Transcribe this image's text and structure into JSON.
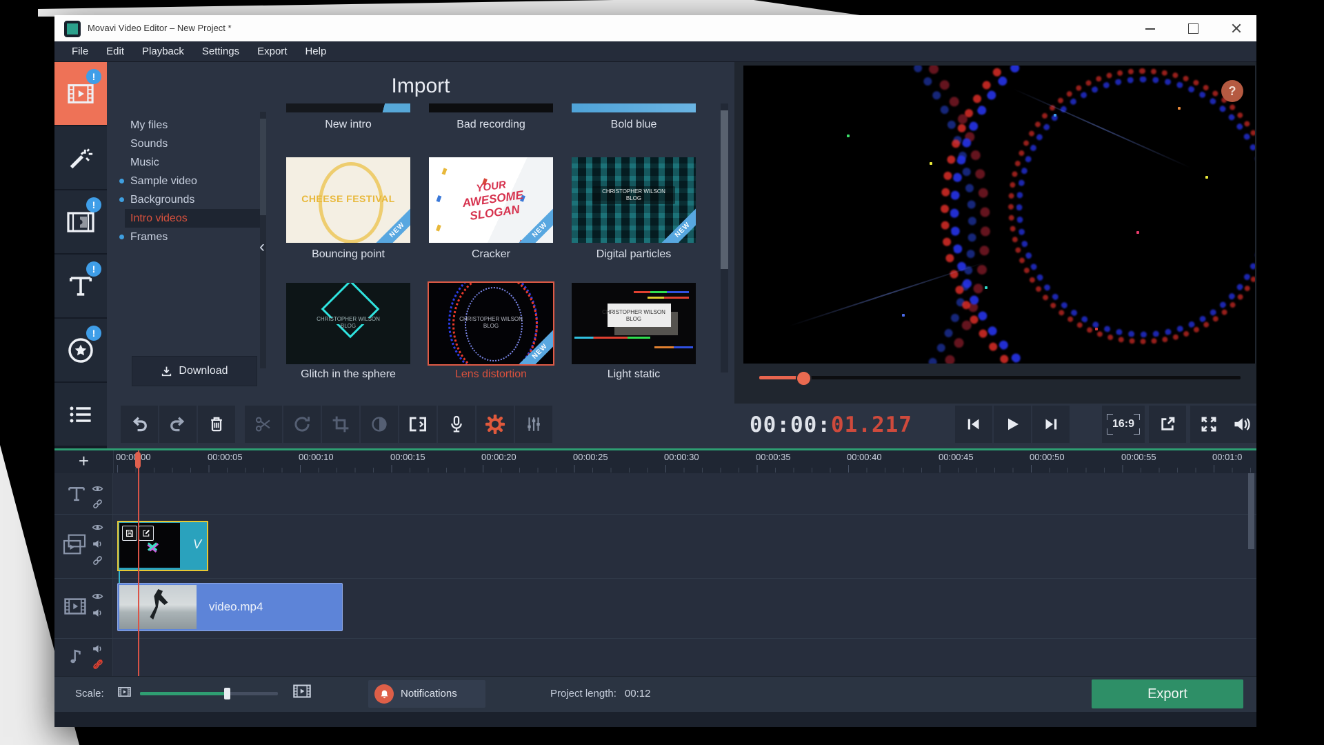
{
  "colors": {
    "accent_orange": "#ee7257",
    "selection_red": "#d9513d",
    "export_green": "#2e8f67",
    "clip_teal": "#2aa2bd",
    "clip_blue": "#5d84d8",
    "new_ribbon_blue": "#58a7e0",
    "timecode_red": "#cf4a3c",
    "scale_green": "#2f9e72"
  },
  "app": {
    "title": "Movavi Video Editor – New Project *",
    "menu": [
      "File",
      "Edit",
      "Playback",
      "Settings",
      "Export",
      "Help"
    ],
    "window_controls": [
      "minimize",
      "maximize",
      "close"
    ]
  },
  "sidebar": {
    "items": [
      {
        "name": "import",
        "badge": "!",
        "active": true
      },
      {
        "name": "filters",
        "active": false
      },
      {
        "name": "transitions",
        "badge": "!",
        "active": false
      },
      {
        "name": "titles",
        "badge": "!",
        "active": false
      },
      {
        "name": "stickers",
        "badge": "!",
        "active": false
      },
      {
        "name": "more-tools",
        "active": false
      }
    ]
  },
  "import_panel": {
    "title": "Import",
    "collapse_icon": "‹",
    "download_label": "Download",
    "categories": [
      {
        "label": "My files",
        "bullet": false,
        "selected": false
      },
      {
        "label": "Sounds",
        "bullet": false,
        "selected": false
      },
      {
        "label": "Music",
        "bullet": false,
        "selected": false
      },
      {
        "label": "Sample video",
        "bullet": true,
        "selected": false
      },
      {
        "label": "Backgrounds",
        "bullet": true,
        "selected": false
      },
      {
        "label": "Intro videos",
        "bullet": false,
        "selected": true
      },
      {
        "label": "Frames",
        "bullet": true,
        "selected": false
      }
    ],
    "row_top": [
      {
        "label": "New intro"
      },
      {
        "label": "Bad recording"
      },
      {
        "label": "Bold blue"
      }
    ],
    "row_middle": [
      {
        "label": "Bouncing point",
        "caption": "CHEESE FESTIVAL",
        "badge": "NEW"
      },
      {
        "label": "Cracker",
        "caption_line1": "YOUR",
        "caption_line2": "AWESOME SLOGAN",
        "badge": "NEW"
      },
      {
        "label": "Digital particles",
        "caption_line1": "CHRISTOPHER WILSON",
        "caption_line2": "BLOG",
        "badge": "NEW"
      }
    ],
    "row_bottom": [
      {
        "label": "Glitch in the sphere",
        "caption_line1": "CHRISTOPHER WILSON",
        "caption_line2": "BLOG"
      },
      {
        "label": "Lens distortion",
        "caption_line1": "CHRISTOPHER WILSON",
        "caption_line2": "BLOG",
        "badge": "NEW",
        "selected": true
      },
      {
        "label": "Light static",
        "caption_line1": "CHRISTOPHER WILSON",
        "caption_line2": "BLOG"
      }
    ]
  },
  "preview": {
    "help": "?",
    "timecode_main": "00:00:",
    "timecode_fraction": "01.217",
    "aspect_ratio": "16:9",
    "controls": [
      "skip-back",
      "play",
      "skip-forward",
      "aspect-ratio",
      "detach-player",
      "fullscreen",
      "volume"
    ]
  },
  "toolbar": {
    "buttons": [
      "undo",
      "redo",
      "delete",
      "cut",
      "rotate",
      "crop",
      "color-adjustments",
      "transition-wizard",
      "record-audio",
      "clip-properties",
      "audio-levels"
    ]
  },
  "timeline": {
    "add_track": "+",
    "ruler": [
      "00:00:00",
      "00:00:05",
      "00:00:10",
      "00:00:15",
      "00:00:20",
      "00:00:25",
      "00:00:30",
      "00:00:35",
      "00:00:40",
      "00:00:45",
      "00:00:50",
      "00:00:55",
      "00:01:0"
    ],
    "tracks": [
      "titles",
      "overlay",
      "video",
      "audio"
    ],
    "overlay_clip_label": "V",
    "video_clip_label": "video.mp4"
  },
  "statusbar": {
    "scale_label": "Scale:",
    "notifications_label": "Notifications",
    "project_length_label": "Project length:",
    "project_length_value": "00:12",
    "export_label": "Export"
  }
}
